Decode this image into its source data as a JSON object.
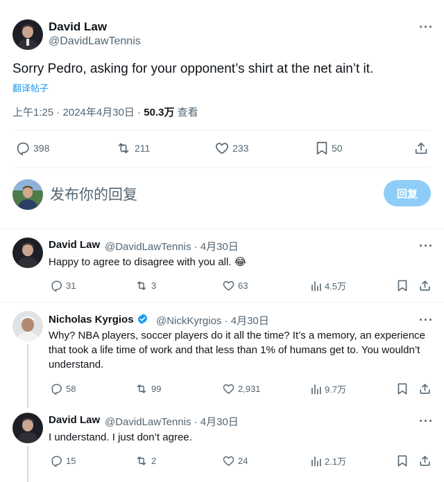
{
  "main_tweet": {
    "author": "David Law",
    "handle": "@DavidLawTennis",
    "text": "Sorry Pedro, asking for your opponent’s shirt at the net ain’t it.",
    "translate": "翻译帖子",
    "time": "上午1:25 · 2024年4月30日 · ",
    "views": "50.3万",
    "views_label": " 查看",
    "stats": {
      "replies": "398",
      "retweets": "211",
      "likes": "233",
      "bookmarks": "50"
    }
  },
  "compose": {
    "placeholder": "发布你的回复",
    "button": "回复"
  },
  "replies": [
    {
      "author": "David Law",
      "handle": "@DavidLawTennis · 4月30日",
      "text": "Happy to agree to disagree with you all. 😂",
      "stats": {
        "replies": "31",
        "retweets": "3",
        "likes": "63",
        "views": "4.5万"
      }
    },
    {
      "author": "Nicholas Kyrgios",
      "handle": "@NickKyrgios · 4月30日",
      "text": "Why? NBA players, soccer players do it all the time? It’s a memory, an experience that took a life time of work and that less than 1% of humans get to. You wouldn’t understand.",
      "stats": {
        "replies": "58",
        "retweets": "99",
        "likes": "2,931",
        "views": "9.7万"
      }
    },
    {
      "author": "David Law",
      "handle": "@DavidLawTennis · 4月30日",
      "text": "I understand. I just don’t agree.",
      "stats": {
        "replies": "15",
        "retweets": "2",
        "likes": "24",
        "views": "2.1万"
      }
    }
  ],
  "colors": {
    "accent": "#1d9bf0",
    "reply_button": "#8ecdf8",
    "secondary_text": "#536471",
    "verified": "#1d9bf0"
  }
}
